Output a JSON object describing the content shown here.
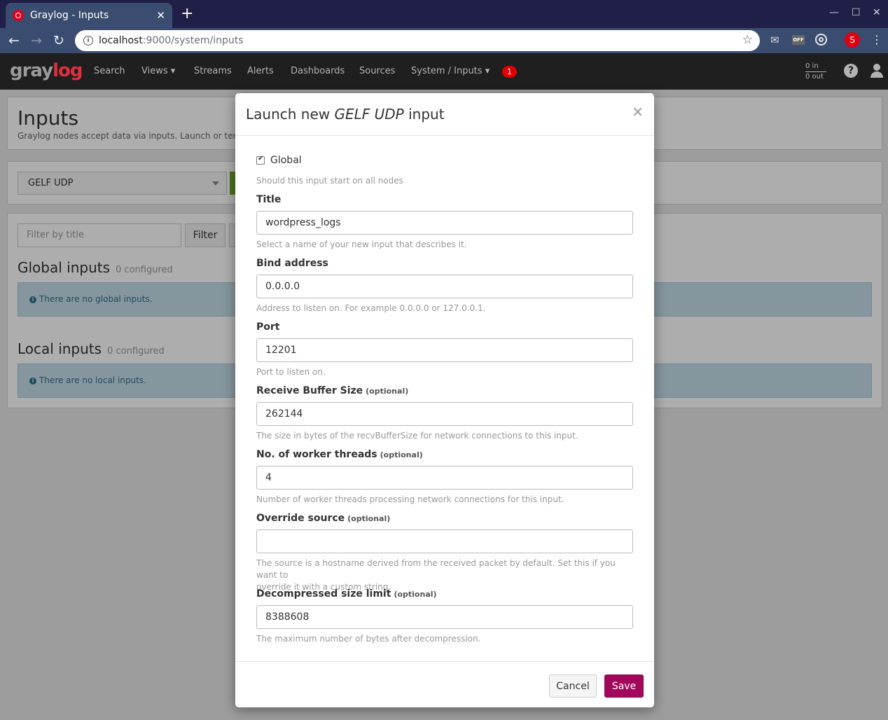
{
  "browser": {
    "tab_title": "Graylog - Inputs",
    "tab_close": "✕",
    "new_tab": "+",
    "url_host": "localhost",
    "url_path": ":9000/system/inputs",
    "profile_initial": "S",
    "ext_off_label": "OFF"
  },
  "navbar": {
    "logo_gray": "gray",
    "logo_log": "log",
    "items": [
      "Search",
      "Views ▾",
      "Streams",
      "Alerts",
      "Dashboards",
      "Sources",
      "System / Inputs ▾"
    ],
    "notification_count": "1",
    "throughput_in": "0 in",
    "throughput_out": "0 out",
    "help": "?"
  },
  "page": {
    "title": "Inputs",
    "description": "Graylog nodes accept data via inputs. Launch or termina",
    "select_value": "GELF UDP",
    "filter_placeholder": "Filter by title",
    "filter_button": "Filter",
    "global_inputs": {
      "title": "Global inputs",
      "count": "0 configured",
      "empty_message": "There are no global inputs."
    },
    "local_inputs": {
      "title": "Local inputs",
      "count": "0 configured",
      "empty_message": "There are no local inputs."
    }
  },
  "modal": {
    "title_prefix": "Launch new ",
    "title_type": "GELF UDP",
    "title_suffix": " input",
    "close": "×",
    "global_label": "Global",
    "global_help": "Should this input start on all nodes",
    "optional_tag": "(optional)",
    "fields": {
      "title": {
        "label": "Title",
        "value": "wordpress_logs",
        "help": "Select a name of your new input that describes it."
      },
      "bind_address": {
        "label": "Bind address",
        "value": "0.0.0.0",
        "help": "Address to listen on. For example 0.0.0.0 or 127.0.0.1."
      },
      "port": {
        "label": "Port",
        "value": "12201",
        "help": "Port to listen on."
      },
      "recv_buffer": {
        "label": "Receive Buffer Size",
        "value": "262144",
        "help": "The size in bytes of the recvBufferSize for network connections to this input."
      },
      "worker_threads": {
        "label": "No. of worker threads",
        "value": "4",
        "help": "Number of worker threads processing network connections for this input."
      },
      "override_source": {
        "label": "Override source",
        "value": "",
        "help_line1": "The source is a hostname derived from the received packet by default. Set this if you want to",
        "help_line2": "override it with a custom string."
      },
      "decompressed_limit": {
        "label": "Decompressed size limit",
        "value": "8388608",
        "help": "The maximum number of bytes after decompression."
      }
    },
    "cancel_label": "Cancel",
    "save_label": "Save"
  }
}
